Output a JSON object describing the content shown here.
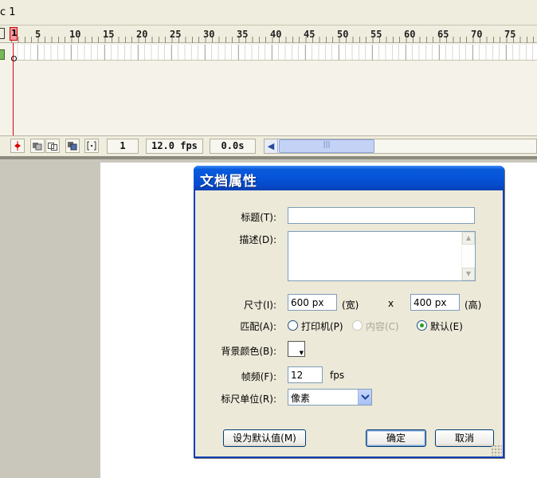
{
  "scene": {
    "label": "c 1"
  },
  "timeline": {
    "ruler_numbers": [
      "1",
      "5",
      "10",
      "15",
      "20",
      "25",
      "30",
      "35",
      "40",
      "45",
      "50",
      "55",
      "60",
      "65",
      "70",
      "75"
    ],
    "current_frame": "1",
    "frame_rate": "12.0 fps",
    "elapsed_time": "0.0s",
    "scroll_left_icon": "left-arrow-icon",
    "buttons": [
      {
        "name": "center-frame-button",
        "icon": "center-frame-icon"
      },
      {
        "name": "onion-skin-button",
        "icon": "onion-skin-icon"
      },
      {
        "name": "onion-skin-outlines-button",
        "icon": "onion-skin-outlines-icon"
      },
      {
        "name": "edit-multiple-frames-button",
        "icon": "edit-multiple-frames-icon"
      },
      {
        "name": "modify-onion-markers-button",
        "icon": "onion-markers-icon"
      }
    ]
  },
  "dialog": {
    "title": "文档属性",
    "title_label": "标题(T):",
    "title_value": "",
    "description_label": "描述(D):",
    "description_value": "",
    "size_label": "尺寸(I):",
    "width_value": "600 px",
    "width_unit": "(宽)",
    "times": "x",
    "height_value": "400 px",
    "height_unit": "(高)",
    "match_label": "匹配(A):",
    "match_options": [
      {
        "label": "打印机(P)",
        "selected": false,
        "enabled": true
      },
      {
        "label": "内容(C)",
        "selected": false,
        "enabled": false
      },
      {
        "label": "默认(E)",
        "selected": true,
        "enabled": true
      }
    ],
    "bg_color_label": "背景颜色(B):",
    "bg_color": "#ffffff",
    "frame_rate_label": "帧频(F):",
    "frame_rate_value": "12",
    "frame_rate_unit": "fps",
    "ruler_units_label": "标尺单位(R):",
    "ruler_units_value": "像素",
    "make_default_button": "设为默认值(M)",
    "ok_button": "确定",
    "cancel_button": "取消"
  },
  "colors": {
    "dialog_title_bar": "#0653d8",
    "dialog_border": "#0a3eb4",
    "playhead": "#dd0000",
    "stage": "#ffffff",
    "pasteboard": "#c9c6bc"
  }
}
